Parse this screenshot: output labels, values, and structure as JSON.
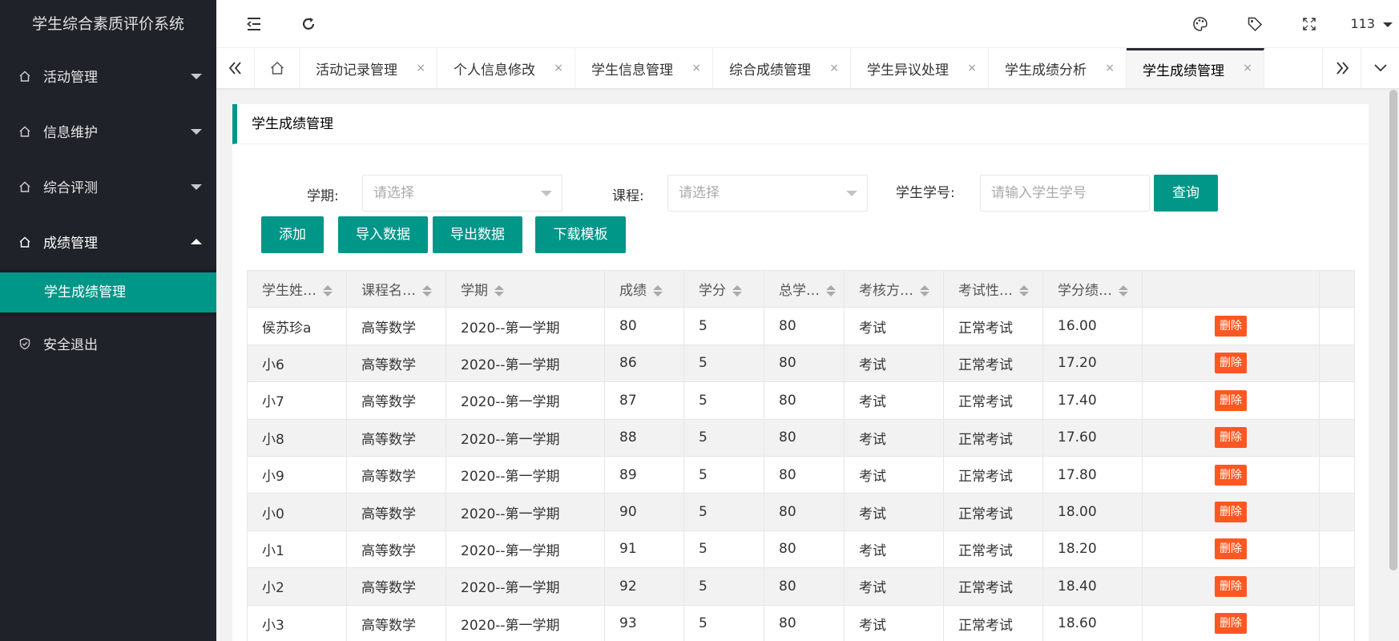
{
  "app": {
    "title": "学生综合素质评价系统"
  },
  "sidebar": {
    "items": [
      {
        "label": "活动管理",
        "state": "collapsed"
      },
      {
        "label": "信息维护",
        "state": "collapsed"
      },
      {
        "label": "综合评测",
        "state": "collapsed"
      },
      {
        "label": "成绩管理",
        "state": "expanded"
      }
    ],
    "submenu": [
      {
        "label": "学生成绩管理",
        "selected": true
      }
    ],
    "logout": {
      "label": "安全退出"
    }
  },
  "header": {
    "user": "113",
    "icons": [
      "menu-fold-icon",
      "refresh-icon",
      "palette-icon",
      "tag-icon",
      "fullscreen-icon"
    ]
  },
  "tabs": {
    "items": [
      {
        "label": "活动记录管理",
        "close": "×"
      },
      {
        "label": "个人信息修改",
        "close": "×"
      },
      {
        "label": "学生信息管理",
        "close": "×"
      },
      {
        "label": "综合成绩管理",
        "close": "×"
      },
      {
        "label": "学生异议处理",
        "close": "×"
      },
      {
        "label": "学生成绩分析",
        "close": "×"
      },
      {
        "label": "学生成绩管理",
        "close": "×",
        "active": true
      }
    ]
  },
  "page": {
    "title": "学生成绩管理",
    "filters": {
      "semester_label": "学期:",
      "semester_placeholder": "请选择",
      "course_label": "课程:",
      "course_placeholder": "请选择",
      "student_no_label": "学生学号:",
      "student_no_placeholder": "请输入学生学号",
      "search_button": "查询"
    },
    "buttons": {
      "add": "添加",
      "import": "导入数据",
      "export": "导出数据",
      "download_template": "下载模板"
    },
    "colors": {
      "accent": "#009688",
      "danger": "#ff5722",
      "sidebar_bg": "#20222a"
    }
  },
  "table": {
    "headers": [
      "学生姓…",
      "课程名…",
      "学期",
      "成绩",
      "学分",
      "总学…",
      "考核方…",
      "考试性…",
      "学分绩…"
    ],
    "delete_label": "删除",
    "rows": [
      [
        "侯苏珍a",
        "高等数学",
        "2020--第一学期",
        "80",
        "5",
        "80",
        "考试",
        "正常考试",
        "16.00"
      ],
      [
        "小6",
        "高等数学",
        "2020--第一学期",
        "86",
        "5",
        "80",
        "考试",
        "正常考试",
        "17.20"
      ],
      [
        "小7",
        "高等数学",
        "2020--第一学期",
        "87",
        "5",
        "80",
        "考试",
        "正常考试",
        "17.40"
      ],
      [
        "小8",
        "高等数学",
        "2020--第一学期",
        "88",
        "5",
        "80",
        "考试",
        "正常考试",
        "17.60"
      ],
      [
        "小9",
        "高等数学",
        "2020--第一学期",
        "89",
        "5",
        "80",
        "考试",
        "正常考试",
        "17.80"
      ],
      [
        "小0",
        "高等数学",
        "2020--第一学期",
        "90",
        "5",
        "80",
        "考试",
        "正常考试",
        "18.00"
      ],
      [
        "小1",
        "高等数学",
        "2020--第一学期",
        "91",
        "5",
        "80",
        "考试",
        "正常考试",
        "18.20"
      ],
      [
        "小2",
        "高等数学",
        "2020--第一学期",
        "92",
        "5",
        "80",
        "考试",
        "正常考试",
        "18.40"
      ],
      [
        "小3",
        "高等数学",
        "2020--第一学期",
        "93",
        "5",
        "80",
        "考试",
        "正常考试",
        "18.60"
      ]
    ]
  }
}
